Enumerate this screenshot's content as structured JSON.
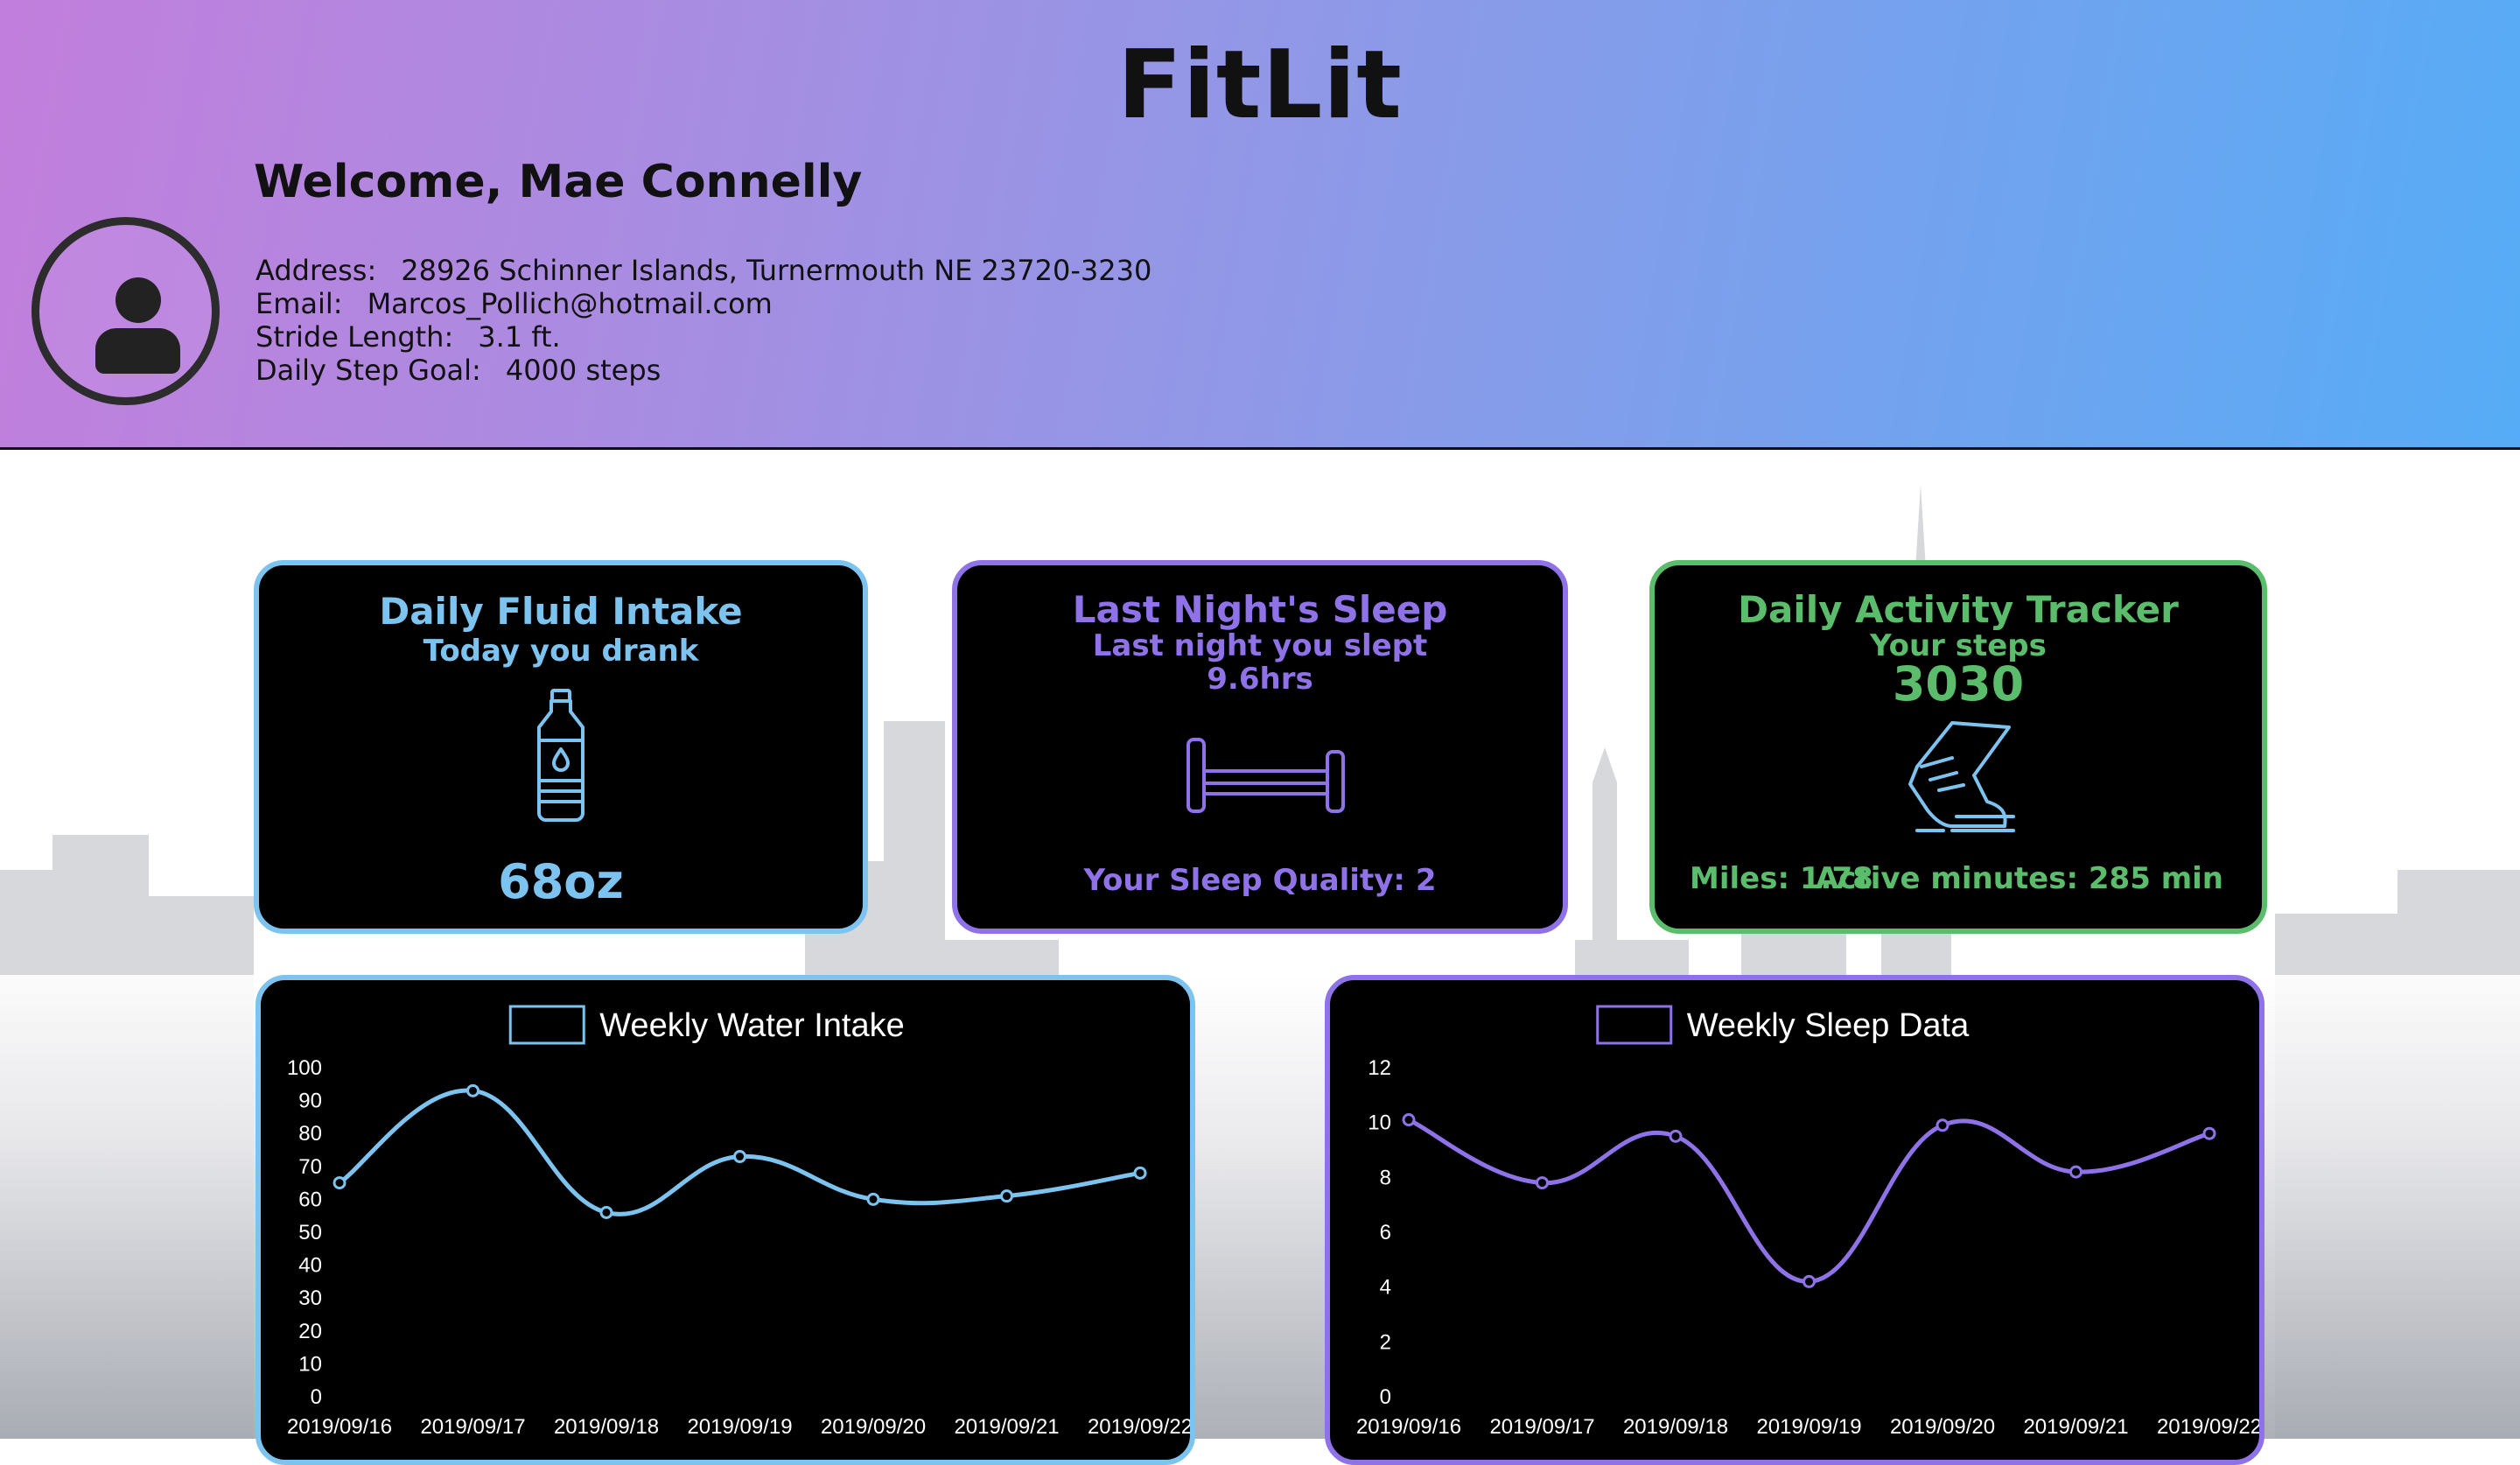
{
  "app": {
    "title": "FitLit"
  },
  "user": {
    "welcome": "Welcome, Mae Connelly",
    "address_label": "Address:",
    "address": "28926 Schinner Islands, Turnermouth NE 23720-3230",
    "email_label": "Email:",
    "email": "Marcos_Pollich@hotmail.com",
    "stride_label": "Stride Length:",
    "stride": "3.1 ft.",
    "goal_label": "Daily Step Goal:",
    "goal": "4000 steps",
    "avatar_icon": "user-avatar-icon"
  },
  "cards": {
    "water": {
      "title": "Daily Fluid Intake",
      "subtitle": "Today you drank",
      "value": "68oz",
      "icon": "water-bottle-icon",
      "color": "#7cc3f0"
    },
    "sleep": {
      "title": "Last Night's Sleep",
      "subtitle": "Last night you slept",
      "hours": "9.6hrs",
      "quality": "Your Sleep Quality: 2",
      "icon": "bed-icon",
      "color": "#8f72e8"
    },
    "activity": {
      "title": "Daily Activity Tracker",
      "subtitle": "Your steps",
      "steps": "3030",
      "miles": "Miles: 1.78",
      "active": "Active minutes: 285 min",
      "icon": "running-shoe-icon",
      "color": "#5bbd6c"
    }
  },
  "chart_data": [
    {
      "type": "line",
      "title": "Weekly Water Intake",
      "color": "#7cc3f0",
      "categories": [
        "2019/09/16",
        "2019/09/17",
        "2019/09/18",
        "2019/09/19",
        "2019/09/20",
        "2019/09/21",
        "2019/09/22"
      ],
      "series": [
        {
          "name": "Weekly Water Intake",
          "values": [
            65,
            93,
            56,
            73,
            60,
            61,
            68
          ]
        }
      ],
      "ylim": [
        0,
        100
      ],
      "yticks": [
        0,
        10,
        20,
        30,
        40,
        50,
        60,
        70,
        80,
        90,
        100
      ],
      "legend": "top"
    },
    {
      "type": "line",
      "title": "Weekly Sleep Data",
      "color": "#8f72e8",
      "categories": [
        "2019/09/16",
        "2019/09/17",
        "2019/09/18",
        "2019/09/19",
        "2019/09/20",
        "2019/09/21",
        "2019/09/22"
      ],
      "series": [
        {
          "name": "Weekly Sleep Data",
          "values": [
            10.1,
            7.8,
            9.5,
            4.2,
            9.9,
            8.2,
            9.6
          ]
        }
      ],
      "ylim": [
        0,
        12
      ],
      "yticks": [
        0,
        2,
        4,
        6,
        8,
        10,
        12
      ],
      "legend": "top"
    }
  ]
}
